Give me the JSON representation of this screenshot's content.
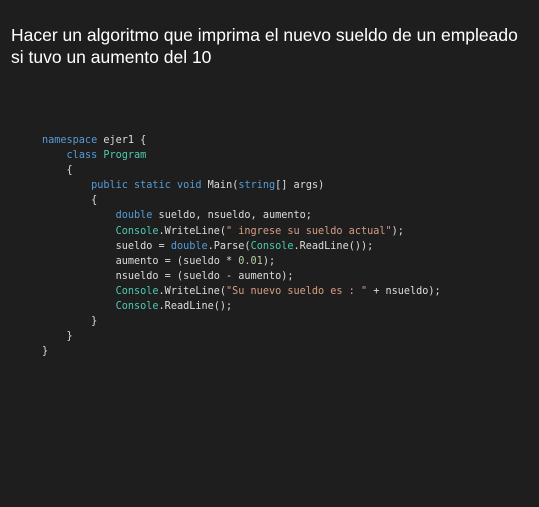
{
  "slide": {
    "title_lines": [
      "Hacer un algoritmo que imprima el nuevo sueldo de un empleado",
      "si tuvo un aumento del 10"
    ]
  },
  "colors": {
    "background": "#1e1e1e",
    "title_text": "#ffffff",
    "keyword": "#569cd6",
    "type": "#4ec9b0",
    "string": "#d69d85",
    "number": "#b5cea8",
    "plain": "#dcdcdc"
  },
  "code": {
    "lines": [
      [
        {
          "t": "kw",
          "v": "namespace"
        },
        {
          "t": "pl",
          "v": " ejer1 {"
        }
      ],
      [
        {
          "t": "pl",
          "v": "    "
        },
        {
          "t": "kw",
          "v": "class"
        },
        {
          "t": "pl",
          "v": " "
        },
        {
          "t": "type",
          "v": "Program"
        }
      ],
      [
        {
          "t": "pl",
          "v": "    {"
        }
      ],
      [
        {
          "t": "pl",
          "v": "        "
        },
        {
          "t": "kw",
          "v": "public"
        },
        {
          "t": "pl",
          "v": " "
        },
        {
          "t": "kw",
          "v": "static"
        },
        {
          "t": "pl",
          "v": " "
        },
        {
          "t": "kw",
          "v": "void"
        },
        {
          "t": "pl",
          "v": " Main("
        },
        {
          "t": "kw",
          "v": "string"
        },
        {
          "t": "pl",
          "v": "[] args)"
        }
      ],
      [
        {
          "t": "pl",
          "v": "        {"
        }
      ],
      [
        {
          "t": "pl",
          "v": "            "
        },
        {
          "t": "kw",
          "v": "double"
        },
        {
          "t": "pl",
          "v": " sueldo, nsueldo, aumento;"
        }
      ],
      [
        {
          "t": "pl",
          "v": "            "
        },
        {
          "t": "type",
          "v": "Console"
        },
        {
          "t": "pl",
          "v": ".WriteLine("
        },
        {
          "t": "str",
          "v": "\" ingrese su sueldo actual\""
        },
        {
          "t": "pl",
          "v": ");"
        }
      ],
      [
        {
          "t": "pl",
          "v": "            sueldo = "
        },
        {
          "t": "kw",
          "v": "double"
        },
        {
          "t": "pl",
          "v": ".Parse("
        },
        {
          "t": "type",
          "v": "Console"
        },
        {
          "t": "pl",
          "v": ".ReadLine());"
        }
      ],
      [
        {
          "t": "pl",
          "v": "            aumento = (sueldo * "
        },
        {
          "t": "num",
          "v": "0.01"
        },
        {
          "t": "pl",
          "v": ");"
        }
      ],
      [
        {
          "t": "pl",
          "v": "            nsueldo = (sueldo - aumento);"
        }
      ],
      [
        {
          "t": "pl",
          "v": "            "
        },
        {
          "t": "type",
          "v": "Console"
        },
        {
          "t": "pl",
          "v": ".WriteLine("
        },
        {
          "t": "str",
          "v": "\"Su nuevo sueldo es : \""
        },
        {
          "t": "pl",
          "v": " + nsueldo);"
        }
      ],
      [
        {
          "t": "pl",
          "v": "            "
        },
        {
          "t": "type",
          "v": "Console"
        },
        {
          "t": "pl",
          "v": ".ReadLine();"
        }
      ],
      [
        {
          "t": "pl",
          "v": "        }"
        }
      ],
      [
        {
          "t": "pl",
          "v": "    }"
        }
      ],
      [
        {
          "t": "pl",
          "v": "}"
        }
      ]
    ]
  }
}
